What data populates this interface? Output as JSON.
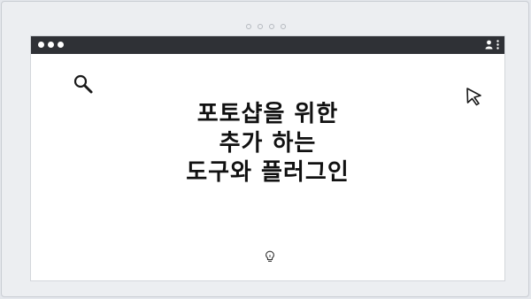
{
  "headline": {
    "line1": "포토샵을 위한",
    "line2": "추가 하는",
    "line3": "도구와 플러그인"
  },
  "icons": {
    "search": "search-icon",
    "cursor": "cursor-icon",
    "lightbulb": "lightbulb-icon",
    "user": "user-icon",
    "menu": "more-vertical-icon"
  },
  "colors": {
    "titlebar": "#2f3136",
    "background": "#eceef1",
    "text": "#111111"
  }
}
